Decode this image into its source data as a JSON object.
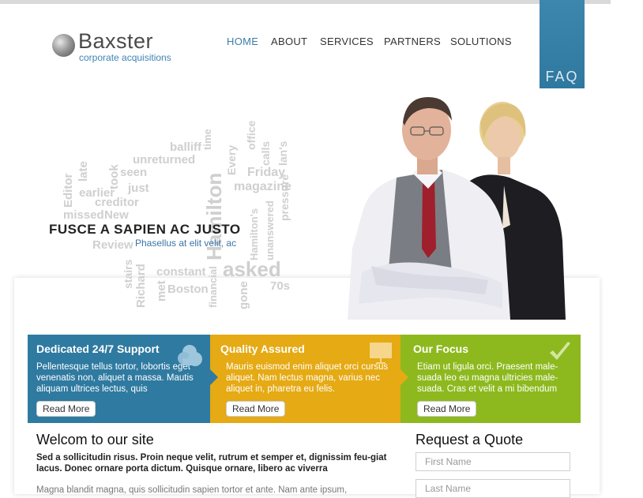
{
  "brand": {
    "name": "Baxster",
    "tagline": "corporate acquisitions"
  },
  "nav": {
    "items": [
      {
        "label": "HOME",
        "active": true
      },
      {
        "label": "ABOUT",
        "active": false
      },
      {
        "label": "SERVICES",
        "active": false
      },
      {
        "label": "PARTNERS",
        "active": false
      },
      {
        "label": "SOLUTIONS",
        "active": false
      }
    ]
  },
  "faq": {
    "label": "FAQ"
  },
  "hero": {
    "title": "FUSCE A SAPIEN AC JUSTO",
    "subtitle": "Phasellus at elit velit, ac"
  },
  "wordcloud": {
    "words": [
      "balliff",
      "time",
      "office",
      "unreturned",
      "Every",
      "calls",
      "seen",
      "lan's",
      "took",
      "Friday",
      "just",
      "Editor",
      "late",
      "earlier",
      "magazine",
      "creditor",
      "missed",
      "New",
      "Hamilton",
      "Review",
      "pressure",
      "unanswered",
      "stairs",
      "constant",
      "asked",
      "Richard",
      "met",
      "Boston",
      "financial",
      "gone",
      "70s",
      "Hamilton's"
    ]
  },
  "features": [
    {
      "title": "Dedicated 24/7 Support",
      "text": "Pellentesque tellus tortor, lobortis eget venenatis non, aliquet a massa. Mautis aliquam ultrices lectus, quis",
      "button": "Read More",
      "icon": "cloud-icon",
      "color": "#2f7aa0"
    },
    {
      "title": "Quality Assured",
      "text": "Mauris euismod enim aliquet orci cursus aliquet. Nam lectus magna, varius nec aliquet in, pharetra eu felis.",
      "button": "Read More",
      "icon": "presentation-board-icon",
      "color": "#e5aa14"
    },
    {
      "title": "Our Focus",
      "text": "Etiam ut ligula orci. Praesent male-suada leo eu magna ultricies male-suada. Cras et velit a mi bibendum",
      "button": "Read More",
      "icon": "checkmark-icon",
      "color": "#8db91e"
    }
  ],
  "welcome": {
    "title": "Welcom to our site",
    "bold_text": "Sed a sollicitudin risus. Proin neque velit, rutrum et semper et, dignissim feu-giat lacus. Donec ornare porta dictum. Quisque ornare, libero ac viverra",
    "body_text": "Magna blandit magna, quis sollicitudin sapien tortor et ante. Nam ante ipsum,"
  },
  "quote": {
    "title": "Request a Quote",
    "first_name_placeholder": "First Name",
    "last_name_placeholder": "Last Name"
  }
}
